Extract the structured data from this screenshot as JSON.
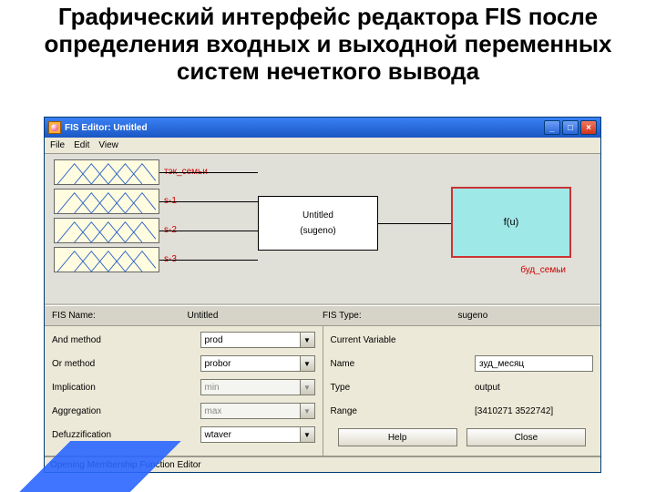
{
  "slide": {
    "title": "Графический интерфейс редактора FIS после определения входных и выходной переменных систем нечеткого вывода"
  },
  "window": {
    "title": "FIS Editor: Untitled",
    "menu": {
      "file": "File",
      "edit": "Edit",
      "view": "View"
    }
  },
  "diagram": {
    "inputs": [
      {
        "label": "тэк_семьи"
      },
      {
        "label": "s-1"
      },
      {
        "label": "s-2"
      },
      {
        "label": "s-3"
      }
    ],
    "center": {
      "name": "Untitled",
      "type": "(sugeno)"
    },
    "output": {
      "fn": "f(u)",
      "label": "буд_семьи"
    }
  },
  "info": {
    "fis_name_lbl": "FIS Name:",
    "fis_name_val": "Untitled",
    "fis_type_lbl": "FIS Type:",
    "fis_type_val": "sugeno"
  },
  "methods": {
    "and_lbl": "And method",
    "and_val": "prod",
    "or_lbl": "Or method",
    "or_val": "probor",
    "imp_lbl": "Implication",
    "imp_val": "min",
    "agg_lbl": "Aggregation",
    "agg_val": "max",
    "def_lbl": "Defuzzification",
    "def_val": "wtaver"
  },
  "current": {
    "heading": "Current Variable",
    "name_lbl": "Name",
    "name_val": "зуд_месяц",
    "type_lbl": "Type",
    "type_val": "output",
    "range_lbl": "Range",
    "range_val": "[3410271 3522742]"
  },
  "buttons": {
    "help": "Help",
    "close": "Close"
  },
  "status": "Opening Membership Function Editor"
}
